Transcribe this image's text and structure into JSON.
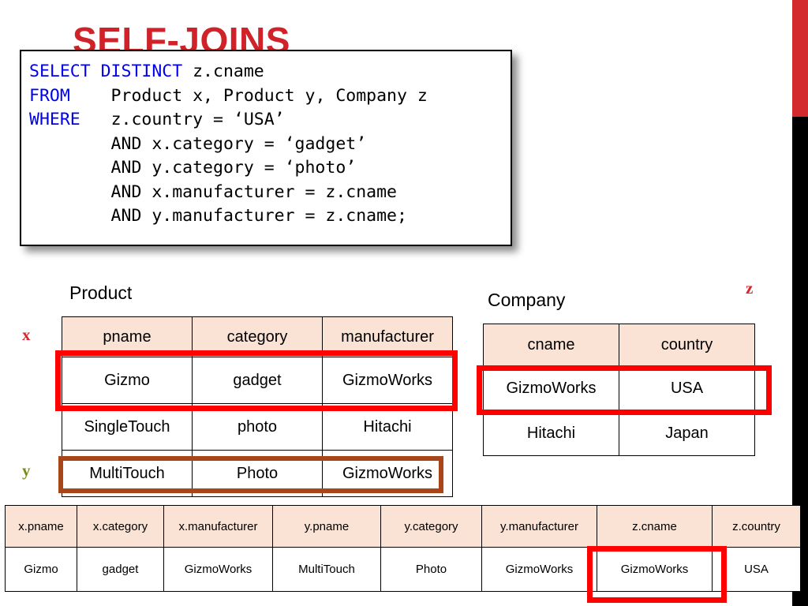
{
  "slide": {
    "title": "SELF-JOINS"
  },
  "sql": {
    "lines": [
      {
        "keyword": "SELECT DISTINCT",
        "rest": " z.cname"
      },
      {
        "keyword": "FROM",
        "rest": "    Product x, Product y, Company z"
      },
      {
        "keyword": "WHERE",
        "rest": "   z.country = ‘USA’"
      },
      {
        "keyword": "",
        "rest": "        AND x.category = ‘gadget’"
      },
      {
        "keyword": "",
        "rest": "        AND y.category = ‘photo’"
      },
      {
        "keyword": "",
        "rest": "        AND x.manufacturer = z.cname"
      },
      {
        "keyword": "",
        "rest": "        AND y.manufacturer = z.cname;"
      }
    ]
  },
  "product": {
    "caption": "Product",
    "columns": [
      "pname",
      "category",
      "manufacturer"
    ],
    "rows": [
      [
        "Gizmo",
        "gadget",
        "GizmoWorks"
      ],
      [
        "SingleTouch",
        "photo",
        "Hitachi"
      ],
      [
        "MultiTouch",
        "Photo",
        "GizmoWorks"
      ]
    ]
  },
  "company": {
    "caption": "Company",
    "columns": [
      "cname",
      "country"
    ],
    "rows": [
      [
        "GizmoWorks",
        "USA"
      ],
      [
        "Hitachi",
        "Japan"
      ]
    ]
  },
  "result": {
    "columns": [
      "x.pname",
      "x.category",
      "x.manufacturer",
      "y.pname",
      "y.category",
      "y.manufacturer",
      "z.cname",
      "z.country"
    ],
    "rows": [
      [
        "Gizmo",
        "gadget",
        "GizmoWorks",
        "MultiTouch",
        "Photo",
        "GizmoWorks",
        "GizmoWorks",
        "USA"
      ]
    ]
  },
  "aliases": {
    "x": "x",
    "y": "y",
    "z": "z"
  },
  "colors": {
    "title_red": "#cf2229",
    "keyword_blue": "#0000ee",
    "header_fill": "#fae3d4",
    "highlight_red": "#ff0000",
    "highlight_brown": "#a8461a",
    "alias_x": "#d7262b",
    "alias_y": "#7a8c12",
    "alias_z": "#d7262b",
    "edge_bar_red": "#d32a2e",
    "edge_bar_black": "#000000"
  }
}
